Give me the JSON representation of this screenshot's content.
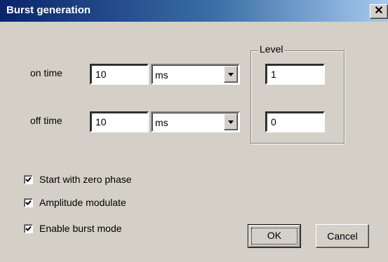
{
  "window": {
    "title": "Burst generation",
    "close_glyph": "✕"
  },
  "timing": {
    "on": {
      "label": "on time",
      "value": "10",
      "unit": "ms"
    },
    "off": {
      "label": "off time",
      "value": "10",
      "unit": "ms"
    }
  },
  "level": {
    "label": "Level",
    "on_value": "1",
    "off_value": "0"
  },
  "options": [
    {
      "label": "Start with zero phase",
      "checked": true
    },
    {
      "label": "Amplitude modulate",
      "checked": true
    },
    {
      "label": "Enable burst mode",
      "checked": true
    }
  ],
  "buttons": {
    "ok": "OK",
    "cancel": "Cancel"
  }
}
